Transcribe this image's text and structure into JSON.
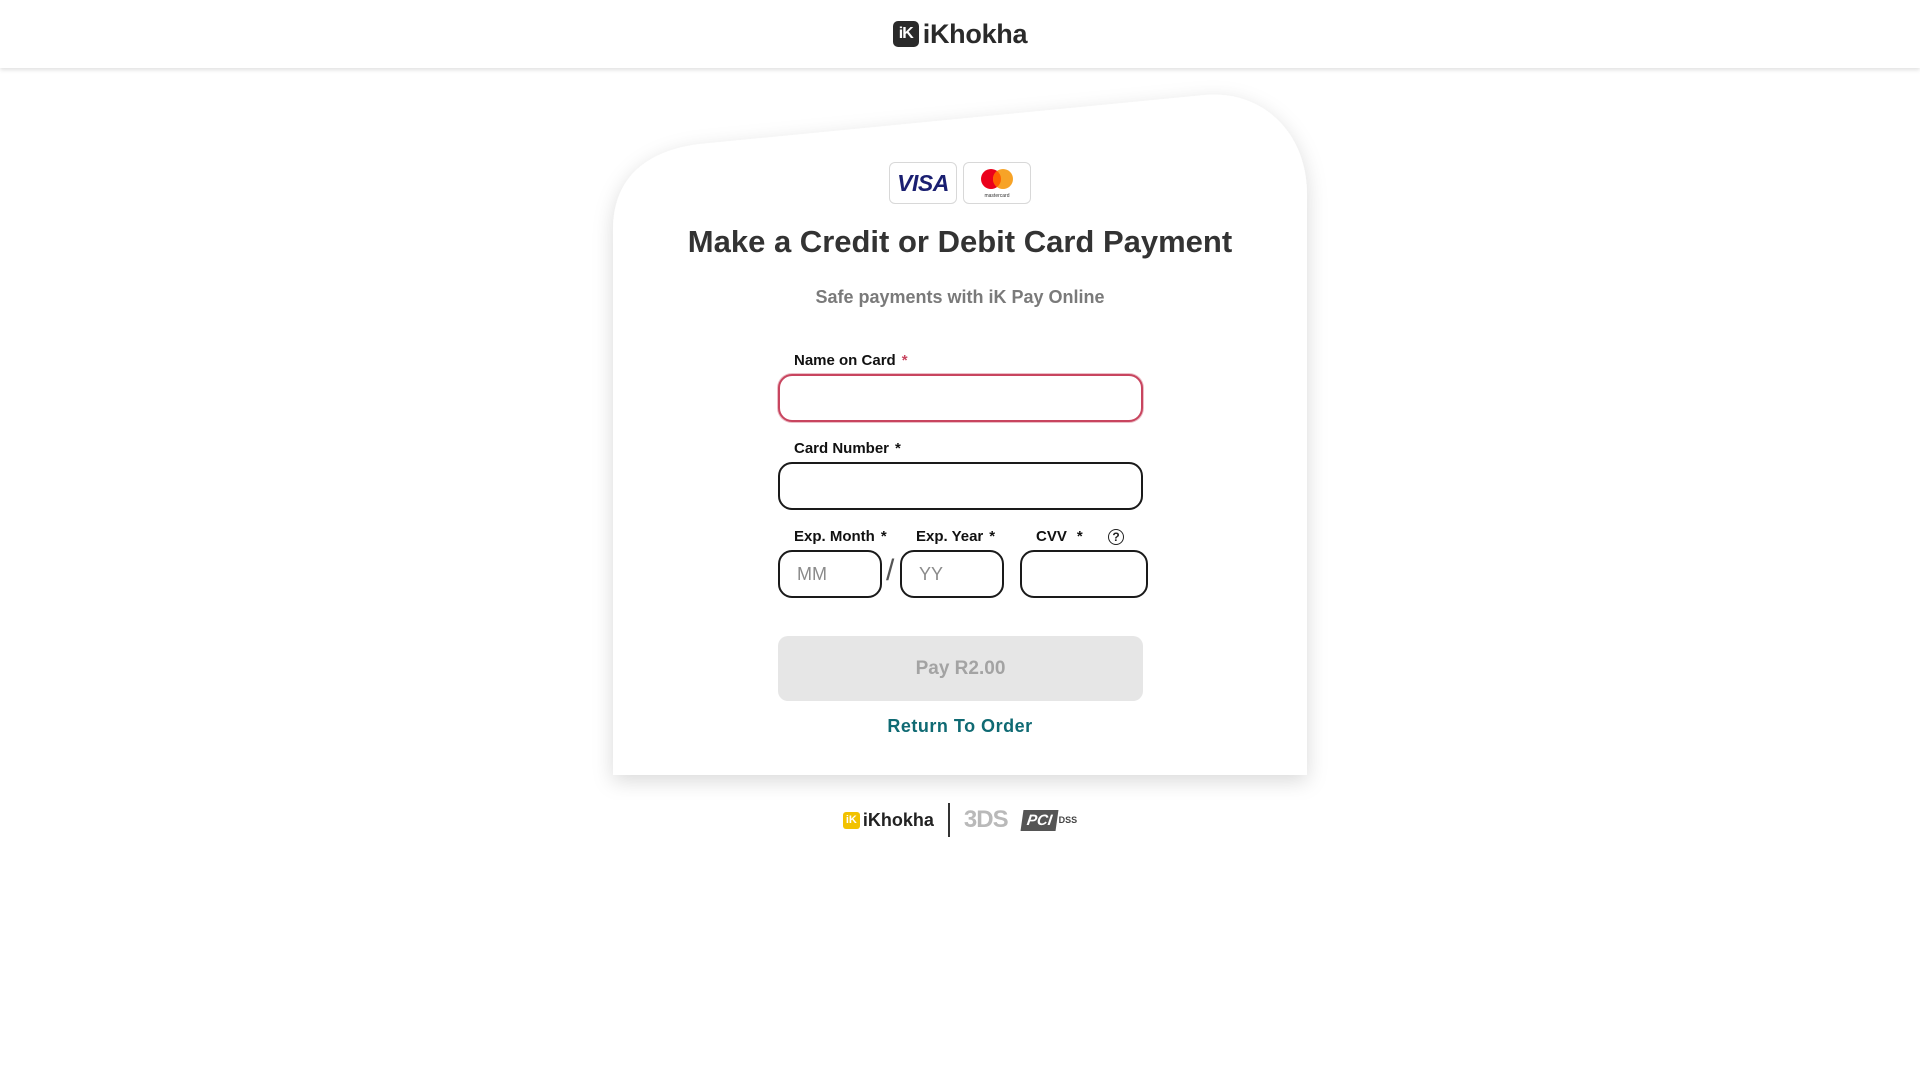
{
  "header": {
    "logo_mark": "iK",
    "logo_text": "iKhokha"
  },
  "card_brands": [
    {
      "name": "VISA",
      "icon": "visa-logo"
    },
    {
      "name": "mastercard",
      "icon": "mastercard-logo"
    }
  ],
  "title": "Make a Credit or Debit Card Payment",
  "subtitle": "Safe payments with iK Pay Online",
  "form": {
    "name_label": "Name on Card",
    "name_value": "",
    "card_number_label": "Card Number",
    "card_number_value": "",
    "exp_month_label": "Exp. Month",
    "exp_month_placeholder": "MM",
    "exp_year_label": "Exp. Year",
    "exp_year_placeholder": "YY",
    "cvv_label": "CVV",
    "cvv_value": "",
    "required_mark": "*",
    "separator": "/",
    "help_icon": "question-circle-icon"
  },
  "pay_button": {
    "label": "Pay R2.00",
    "state": "disabled"
  },
  "return_link": "Return To Order",
  "footer": {
    "ikhokha_mark": "iK",
    "ikhokha_text": "iKhokha",
    "threeds_text": "3DS",
    "pci_text": "PCI",
    "dss_text": "DSS"
  },
  "colors": {
    "error_border": "#c8455f",
    "link": "#0f6a73",
    "disabled_button": "#e6e6e6",
    "brand_dark": "#2a2a2a",
    "footer_logo": "#f2c200"
  }
}
